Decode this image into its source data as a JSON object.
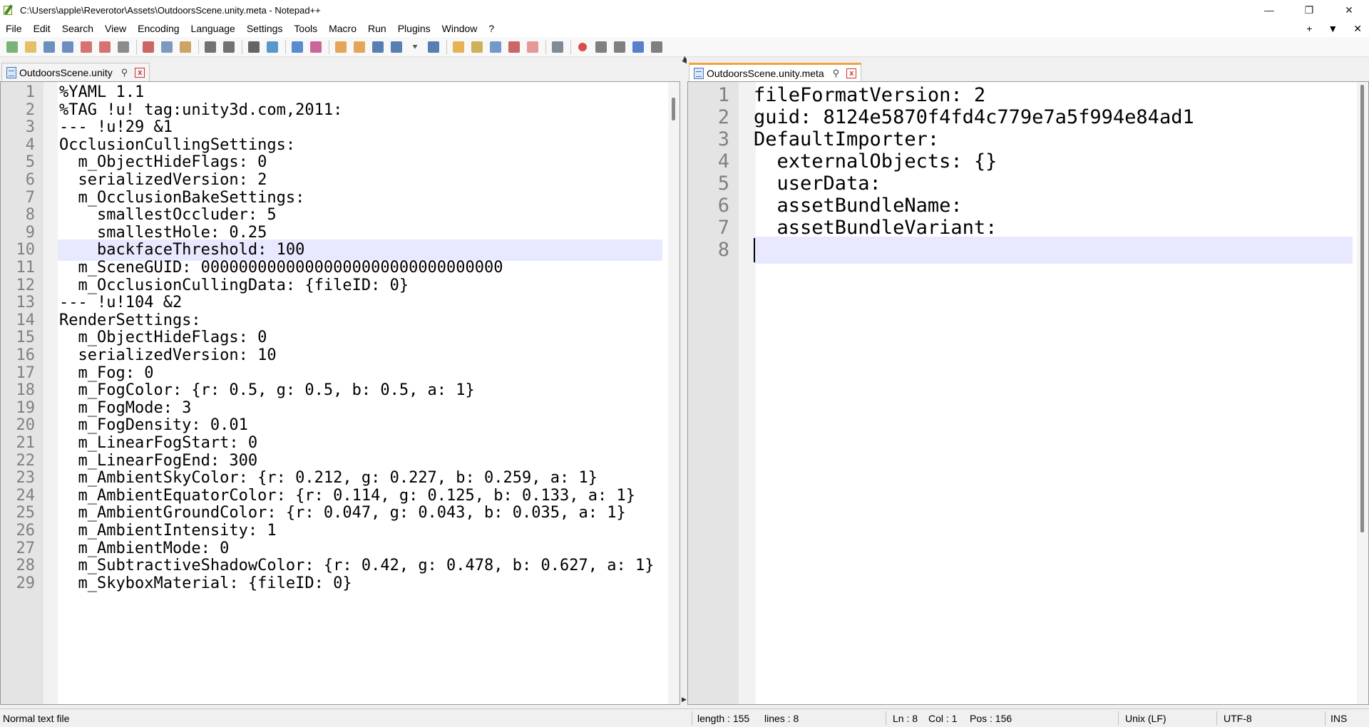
{
  "window": {
    "title": "C:\\Users\\apple\\Reverotor\\Assets\\OutdoorsScene.unity.meta - Notepad++",
    "controls": {
      "minimize": "—",
      "restore": "❐",
      "close": "✕"
    }
  },
  "menu": {
    "items": [
      "File",
      "Edit",
      "Search",
      "View",
      "Encoding",
      "Language",
      "Settings",
      "Tools",
      "Macro",
      "Run",
      "Plugins",
      "Window",
      "?"
    ],
    "right": {
      "add": "+",
      "dropdown": "▼",
      "close": "✕"
    }
  },
  "toolbar": {
    "icons": [
      {
        "name": "new-file-icon",
        "color": "#5aa05a"
      },
      {
        "name": "open-file-icon",
        "color": "#e0b040"
      },
      {
        "name": "save-icon",
        "color": "#4a74b0"
      },
      {
        "name": "save-all-icon",
        "color": "#4a74b0"
      },
      {
        "name": "close-file-icon",
        "color": "#d05050"
      },
      {
        "name": "close-all-icon",
        "color": "#d05050"
      },
      {
        "name": "print-icon",
        "color": "#707070"
      },
      {
        "sep": true
      },
      {
        "name": "cut-icon",
        "color": "#c04040"
      },
      {
        "name": "copy-icon",
        "color": "#6080b0"
      },
      {
        "name": "paste-icon",
        "color": "#c09040"
      },
      {
        "sep": true
      },
      {
        "name": "undo-icon",
        "color": "#505050"
      },
      {
        "name": "redo-icon",
        "color": "#505050"
      },
      {
        "sep": true
      },
      {
        "name": "find-icon",
        "color": "#404040"
      },
      {
        "name": "replace-icon",
        "color": "#3080c0"
      },
      {
        "sep": true
      },
      {
        "name": "zoom-in-icon",
        "color": "#3070c0"
      },
      {
        "name": "zoom-out-icon",
        "color": "#c04080"
      },
      {
        "sep": true
      },
      {
        "name": "sync-vertical-icon",
        "color": "#e09030"
      },
      {
        "name": "sync-horizontal-icon",
        "color": "#e09030"
      },
      {
        "name": "word-wrap-icon",
        "color": "#3060a0"
      },
      {
        "name": "show-all-chars-icon",
        "color": "#3060a0"
      },
      {
        "name": "dropdown-icon",
        "color": "#303030"
      },
      {
        "name": "indent-guide-icon",
        "color": "#3060a0"
      },
      {
        "sep": true
      },
      {
        "name": "user-lang-icon",
        "color": "#e0a030"
      },
      {
        "name": "doc-map-icon",
        "color": "#c0a030"
      },
      {
        "name": "doc-list-icon",
        "color": "#5080c0"
      },
      {
        "name": "function-list-icon",
        "color": "#c04040"
      },
      {
        "name": "folder-workspace-icon",
        "color": "#e08080"
      },
      {
        "sep": true
      },
      {
        "name": "monitoring-icon",
        "color": "#607080"
      },
      {
        "sep": true
      },
      {
        "name": "record-macro-icon",
        "color": "#d02020"
      },
      {
        "name": "stop-macro-icon",
        "color": "#606060"
      },
      {
        "name": "play-macro-icon",
        "color": "#606060"
      },
      {
        "name": "run-macro-multiple-icon",
        "color": "#3060c0"
      },
      {
        "name": "save-macro-icon",
        "color": "#606060"
      }
    ]
  },
  "tabs": {
    "left": {
      "label": "OutdoorsScene.unity",
      "pin": "⚲",
      "close": "x"
    },
    "right": {
      "label": "OutdoorsScene.unity.meta",
      "pin": "⚲",
      "close": "x"
    }
  },
  "splitter": {
    "up": "▲",
    "down": "▼",
    "left": "◀",
    "right": "▶"
  },
  "editors": {
    "left": {
      "current_line": 10,
      "lines": [
        {
          "n": "1",
          "text": "%YAML 1.1"
        },
        {
          "n": "2",
          "text": "%TAG !u! tag:unity3d.com,2011:"
        },
        {
          "n": "3",
          "text": "--- !u!29 &1"
        },
        {
          "n": "4",
          "text": "OcclusionCullingSettings:"
        },
        {
          "n": "5",
          "text": "  m_ObjectHideFlags: 0"
        },
        {
          "n": "6",
          "text": "  serializedVersion: 2"
        },
        {
          "n": "7",
          "text": "  m_OcclusionBakeSettings:"
        },
        {
          "n": "8",
          "text": "    smallestOccluder: 5"
        },
        {
          "n": "9",
          "text": "    smallestHole: 0.25"
        },
        {
          "n": "10",
          "text": "    backfaceThreshold: 100"
        },
        {
          "n": "11",
          "text": "  m_SceneGUID: 00000000000000000000000000000000"
        },
        {
          "n": "12",
          "text": "  m_OcclusionCullingData: {fileID: 0}"
        },
        {
          "n": "13",
          "text": "--- !u!104 &2"
        },
        {
          "n": "14",
          "text": "RenderSettings:"
        },
        {
          "n": "15",
          "text": "  m_ObjectHideFlags: 0"
        },
        {
          "n": "16",
          "text": "  serializedVersion: 10"
        },
        {
          "n": "17",
          "text": "  m_Fog: 0"
        },
        {
          "n": "18",
          "text": "  m_FogColor: {r: 0.5, g: 0.5, b: 0.5, a: 1}"
        },
        {
          "n": "19",
          "text": "  m_FogMode: 3"
        },
        {
          "n": "20",
          "text": "  m_FogDensity: 0.01"
        },
        {
          "n": "21",
          "text": "  m_LinearFogStart: 0"
        },
        {
          "n": "22",
          "text": "  m_LinearFogEnd: 300"
        },
        {
          "n": "23",
          "text": "  m_AmbientSkyColor: {r: 0.212, g: 0.227, b: 0.259, a: 1}"
        },
        {
          "n": "24",
          "text": "  m_AmbientEquatorColor: {r: 0.114, g: 0.125, b: 0.133, a: 1}"
        },
        {
          "n": "25",
          "text": "  m_AmbientGroundColor: {r: 0.047, g: 0.043, b: 0.035, a: 1}"
        },
        {
          "n": "26",
          "text": "  m_AmbientIntensity: 1"
        },
        {
          "n": "27",
          "text": "  m_AmbientMode: 0"
        },
        {
          "n": "28",
          "text": "  m_SubtractiveShadowColor: {r: 0.42, g: 0.478, b: 0.627, a: 1}"
        },
        {
          "n": "29",
          "text": "  m_SkyboxMaterial: {fileID: 0}"
        }
      ]
    },
    "right": {
      "current_line": 8,
      "lines": [
        {
          "n": "1",
          "text": "fileFormatVersion: 2"
        },
        {
          "n": "2",
          "text": "guid: 8124e5870f4fd4c779e7a5f994e84ad1"
        },
        {
          "n": "3",
          "text": "DefaultImporter:"
        },
        {
          "n": "4",
          "text": "  externalObjects: {}"
        },
        {
          "n": "5",
          "text": "  userData:"
        },
        {
          "n": "6",
          "text": "  assetBundleName:"
        },
        {
          "n": "7",
          "text": "  assetBundleVariant:"
        },
        {
          "n": "8",
          "text": ""
        }
      ]
    }
  },
  "status": {
    "file_type": "Normal text file",
    "length": "length : 155",
    "lines": "lines : 8",
    "ln": "Ln : 8",
    "col": "Col : 1",
    "pos": "Pos : 156",
    "eol": "Unix (LF)",
    "encoding": "UTF-8",
    "mode": "INS"
  },
  "colors": {
    "current_line_highlight": "#e8e8ff",
    "active_tab_accent": "#f2a33a",
    "gutter": "#e4e4e4",
    "line_number": "#808080"
  }
}
